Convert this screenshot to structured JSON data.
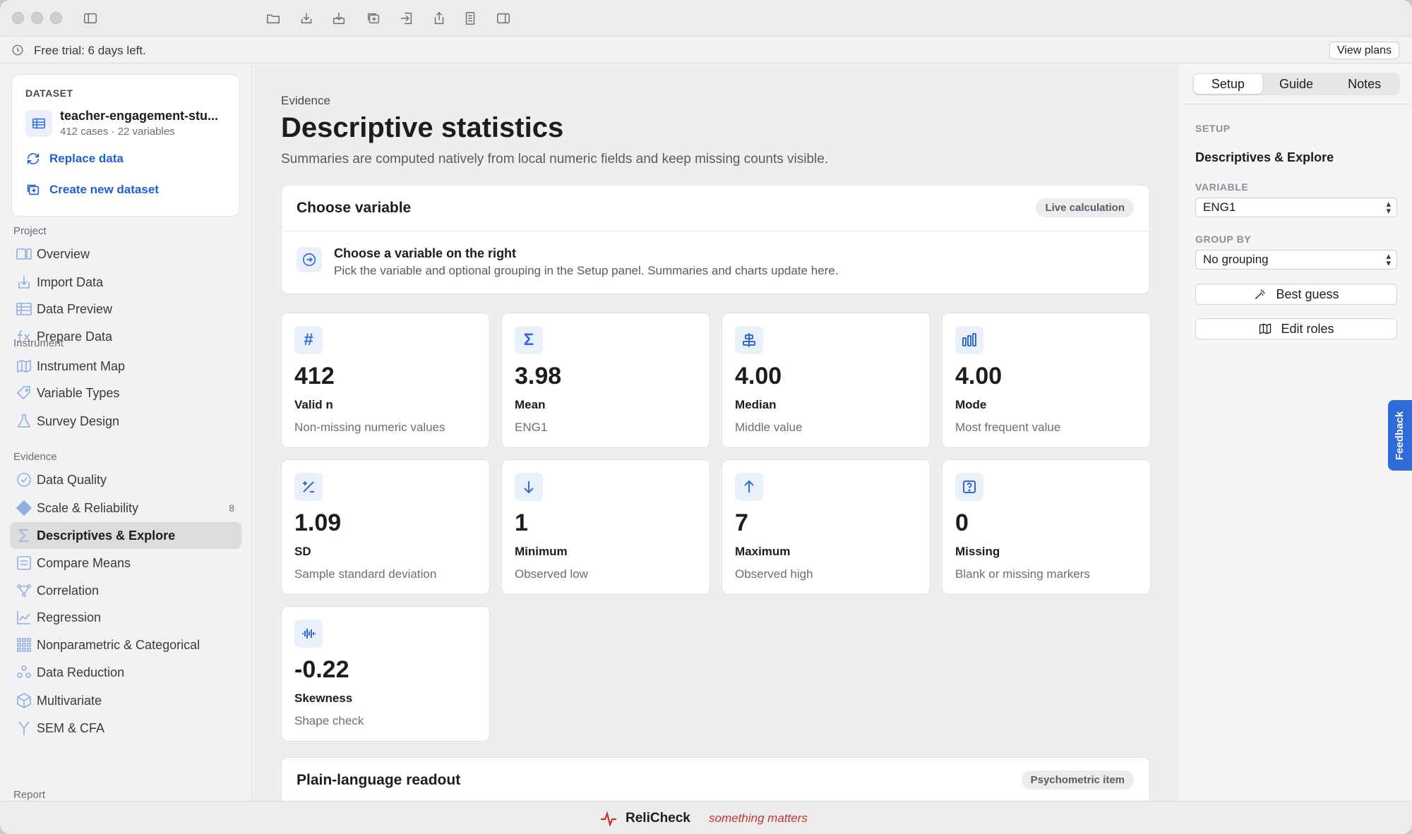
{
  "trial": {
    "text": "Free trial: 6 days left.",
    "button": "View plans"
  },
  "dataset": {
    "label": "DATASET",
    "name": "teacher-engagement-stu...",
    "meta": "412 cases · 22 variables",
    "replace": "Replace data",
    "create": "Create new dataset"
  },
  "nav": {
    "project": {
      "label": "Project",
      "items": [
        "Overview",
        "Import Data",
        "Data Preview",
        "Prepare Data"
      ]
    },
    "instrument": {
      "label": "Instrument",
      "items": [
        "Instrument Map",
        "Variable Types",
        "Survey Design"
      ]
    },
    "evidence": {
      "label": "Evidence",
      "items": [
        "Data Quality",
        "Scale & Reliability",
        "Descriptives & Explore",
        "Compare Means",
        "Correlation",
        "Regression",
        "Nonparametric & Categorical",
        "Data Reduction",
        "Multivariate",
        "SEM & CFA"
      ],
      "badge": "8"
    },
    "report": {
      "label": "Report"
    }
  },
  "main": {
    "eyebrow": "Evidence",
    "title": "Descriptive statistics",
    "subtitle": "Summaries are computed natively from local numeric fields and keep missing counts visible.",
    "choose": {
      "title": "Choose variable",
      "pill": "Live calculation",
      "hint_title": "Choose a variable on the right",
      "hint_text": "Pick the variable and optional grouping in the Setup panel. Summaries and charts update here."
    },
    "stats": [
      {
        "value": "412",
        "name": "Valid n",
        "desc": "Non-missing numeric values",
        "icon": "hash-icon"
      },
      {
        "value": "3.98",
        "name": "Mean",
        "desc": "ENG1",
        "icon": "sigma-icon"
      },
      {
        "value": "4.00",
        "name": "Median",
        "desc": "Middle value",
        "icon": "align-center-icon"
      },
      {
        "value": "4.00",
        "name": "Mode",
        "desc": "Most frequent value",
        "icon": "bar-chart-icon"
      },
      {
        "value": "1.09",
        "name": "SD",
        "desc": "Sample standard deviation",
        "icon": "plus-minus-icon"
      },
      {
        "value": "1",
        "name": "Minimum",
        "desc": "Observed low",
        "icon": "arrow-down-icon"
      },
      {
        "value": "7",
        "name": "Maximum",
        "desc": "Observed high",
        "icon": "arrow-up-icon"
      },
      {
        "value": "0",
        "name": "Missing",
        "desc": "Blank or missing markers",
        "icon": "question-box-icon"
      },
      {
        "value": "-0.22",
        "name": "Skewness",
        "desc": "Shape check",
        "icon": "waveform-icon"
      }
    ],
    "readout": {
      "title": "Plain-language readout",
      "pill": "Psychometric item"
    }
  },
  "setup": {
    "tabs": [
      "Setup",
      "Guide",
      "Notes"
    ],
    "section": "SETUP",
    "title": "Descriptives & Explore",
    "variable_label": "VARIABLE",
    "variable_value": "ENG1",
    "group_label": "GROUP BY",
    "group_value": "No grouping",
    "best_guess": "Best guess",
    "edit_roles": "Edit roles"
  },
  "feedback": "Feedback",
  "footer": {
    "brand": "ReliCheck",
    "tagline": "something matters"
  },
  "colors": {
    "accent": "#2f6bd8",
    "tagline": "#c0392b"
  }
}
